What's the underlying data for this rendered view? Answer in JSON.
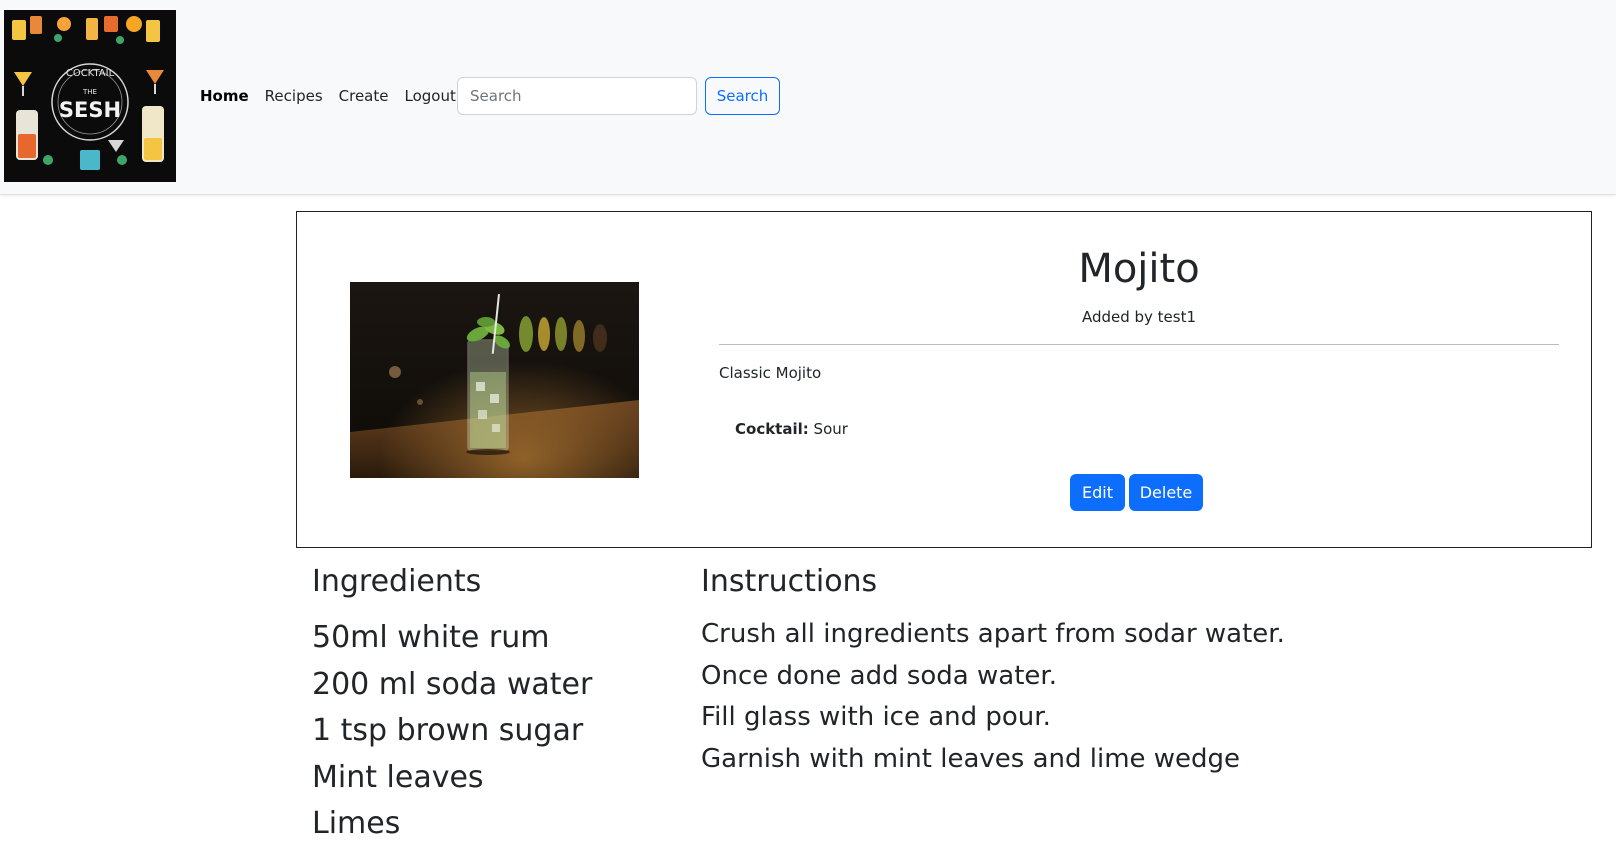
{
  "brand": {
    "logo_text_top": "COCKTAIL",
    "logo_text_the": "THE",
    "logo_text_main": "SESH"
  },
  "nav": {
    "links": [
      "Home",
      "Recipes",
      "Create",
      "Logout"
    ],
    "active": "Home",
    "search_placeholder": "Search",
    "search_value": "",
    "search_button": "Search"
  },
  "recipe": {
    "image_alt": "Mojito cocktail in a tall glass on a bar",
    "title": "Mojito",
    "added_by": "Added by test1",
    "description": "Classic Mojito",
    "category_label": "Cocktail:",
    "category_value": "Sour",
    "edit_label": "Edit",
    "delete_label": "Delete"
  },
  "ingredients": {
    "heading": "Ingredients",
    "items": [
      "50ml white rum",
      "200 ml soda water",
      "1 tsp brown sugar",
      "Mint leaves",
      "Limes"
    ]
  },
  "instructions": {
    "heading": "Instructions",
    "steps": [
      "Crush all ingredients apart from sodar water.",
      "Once done add soda water.",
      "Fill glass with ice and pour.",
      "Garnish with mint leaves and lime wedge"
    ]
  },
  "colors": {
    "primary": "#0d6efd",
    "navbar_bg": "#f8f9fa",
    "text": "#212529"
  }
}
